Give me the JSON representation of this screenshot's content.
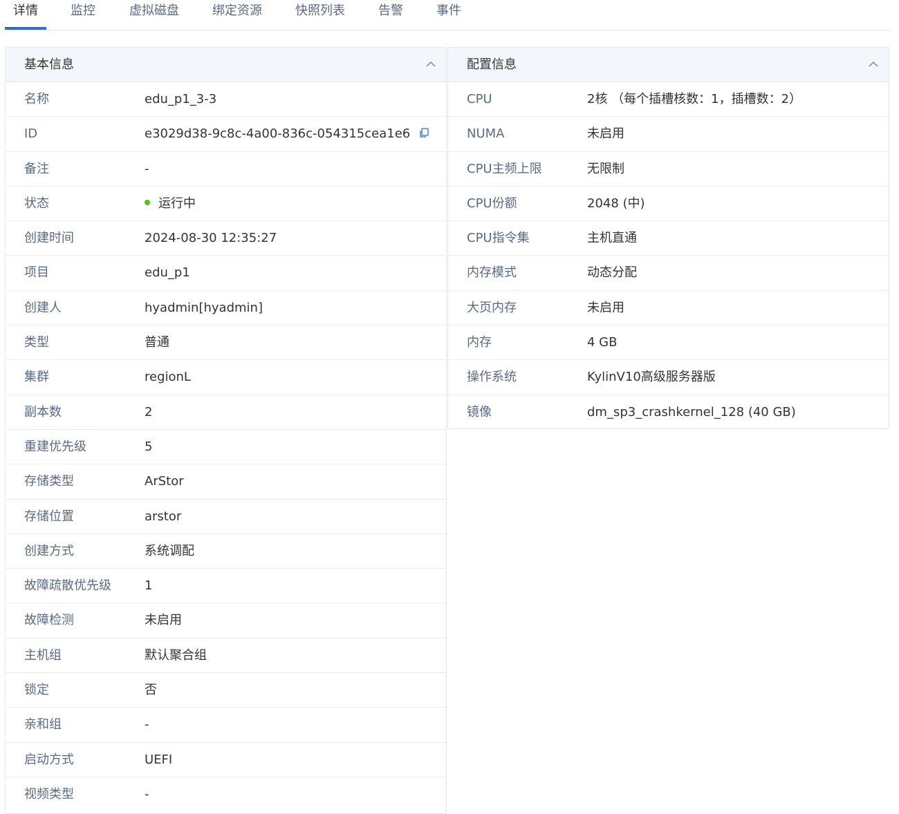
{
  "tabs": [
    {
      "label": "详情",
      "active": true
    },
    {
      "label": "监控",
      "active": false
    },
    {
      "label": "虚拟磁盘",
      "active": false
    },
    {
      "label": "绑定资源",
      "active": false
    },
    {
      "label": "快照列表",
      "active": false
    },
    {
      "label": "告警",
      "active": false
    },
    {
      "label": "事件",
      "active": false
    }
  ],
  "basic": {
    "title": "基本信息",
    "rows": [
      {
        "label": "名称",
        "value": "edu_p1_3-3"
      },
      {
        "label": "ID",
        "value": "e3029d38-9c8c-4a00-836c-054315cea1e6"
      },
      {
        "label": "备注",
        "value": "-"
      },
      {
        "label": "状态",
        "value": "运行中"
      },
      {
        "label": "创建时间",
        "value": "2024-08-30 12:35:27"
      },
      {
        "label": "项目",
        "value": "edu_p1"
      },
      {
        "label": "创建人",
        "value": "hyadmin[hyadmin]"
      },
      {
        "label": "类型",
        "value": "普通"
      },
      {
        "label": "集群",
        "value": "regionL"
      },
      {
        "label": "副本数",
        "value": "2"
      },
      {
        "label": "重建优先级",
        "value": "5"
      },
      {
        "label": "存储类型",
        "value": "ArStor"
      },
      {
        "label": "存储位置",
        "value": "arstor"
      },
      {
        "label": "创建方式",
        "value": "系统调配"
      },
      {
        "label": "故障疏散优先级",
        "value": "1"
      },
      {
        "label": "故障检测",
        "value": "未启用"
      },
      {
        "label": "主机组",
        "value": "默认聚合组"
      },
      {
        "label": "锁定",
        "value": "否"
      },
      {
        "label": "亲和组",
        "value": "-"
      },
      {
        "label": "启动方式",
        "value": "UEFI"
      },
      {
        "label": "视频类型",
        "value": "-"
      }
    ]
  },
  "config": {
    "title": "配置信息",
    "rows": [
      {
        "label": "CPU",
        "value": "2核 （每个插槽核数：1，插槽数：2）"
      },
      {
        "label": "NUMA",
        "value": "未启用"
      },
      {
        "label": "CPU主频上限",
        "value": "无限制"
      },
      {
        "label": "CPU份额",
        "value": "2048 (中)"
      },
      {
        "label": "CPU指令集",
        "value": "主机直通"
      },
      {
        "label": "内存模式",
        "value": "动态分配"
      },
      {
        "label": "大页内存",
        "value": "未启用"
      },
      {
        "label": "内存",
        "value": "4 GB"
      },
      {
        "label": "操作系统",
        "value": "KylinV10高级服务器版"
      },
      {
        "label": "镜像",
        "value": "dm_sp3_crashkernel_128 (40 GB)"
      }
    ]
  },
  "colors": {
    "accent": "#2a6fcd",
    "status_running": "#52c41a",
    "label": "#5a6a85"
  },
  "icons": {
    "collapse": "chevron-up-icon",
    "copy": "copy-icon",
    "status": "status-dot"
  }
}
